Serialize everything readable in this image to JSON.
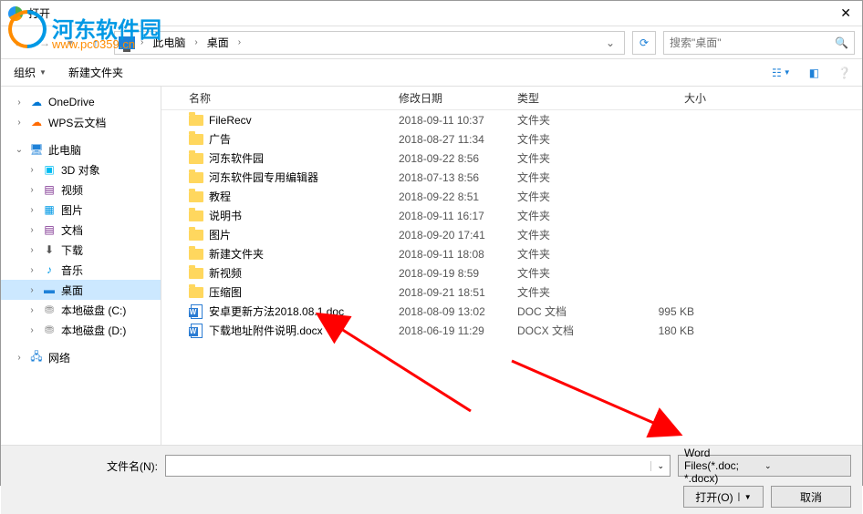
{
  "window": {
    "title": "打开"
  },
  "watermark": {
    "text": "河东软件园",
    "url": "www.pc0359.cn"
  },
  "breadcrumb": {
    "loc": "此电脑",
    "path": "桌面"
  },
  "search": {
    "placeholder": "搜索\"桌面\""
  },
  "toolbar": {
    "organize": "组织",
    "newfolder": "新建文件夹"
  },
  "sidebar": {
    "items": [
      {
        "label": "OneDrive",
        "indent": 1,
        "icon": "onedrive",
        "exp": ">"
      },
      {
        "label": "WPS云文档",
        "indent": 1,
        "icon": "wps",
        "exp": ">"
      },
      {
        "label": "",
        "spacer": true
      },
      {
        "label": "此电脑",
        "indent": 1,
        "icon": "pc",
        "exp": "v"
      },
      {
        "label": "3D 对象",
        "indent": 2,
        "icon": "3d",
        "exp": ">"
      },
      {
        "label": "视频",
        "indent": 2,
        "icon": "video",
        "exp": ">"
      },
      {
        "label": "图片",
        "indent": 2,
        "icon": "pic",
        "exp": ">"
      },
      {
        "label": "文档",
        "indent": 2,
        "icon": "doc",
        "exp": ">"
      },
      {
        "label": "下载",
        "indent": 2,
        "icon": "dl",
        "exp": ">"
      },
      {
        "label": "音乐",
        "indent": 2,
        "icon": "music",
        "exp": ">"
      },
      {
        "label": "桌面",
        "indent": 2,
        "icon": "desktop",
        "exp": ">",
        "selected": true
      },
      {
        "label": "本地磁盘 (C:)",
        "indent": 2,
        "icon": "drive",
        "exp": ">"
      },
      {
        "label": "本地磁盘 (D:)",
        "indent": 2,
        "icon": "drive",
        "exp": ">"
      },
      {
        "label": "",
        "spacer": true
      },
      {
        "label": "网络",
        "indent": 1,
        "icon": "net",
        "exp": ">"
      }
    ]
  },
  "columns": {
    "name": "名称",
    "date": "修改日期",
    "type": "类型",
    "size": "大小"
  },
  "files": [
    {
      "name": "FileRecv",
      "date": "2018-09-11 10:37",
      "type": "文件夹",
      "size": "",
      "kind": "folder"
    },
    {
      "name": "广告",
      "date": "2018-08-27 11:34",
      "type": "文件夹",
      "size": "",
      "kind": "folder"
    },
    {
      "name": "河东软件园",
      "date": "2018-09-22 8:56",
      "type": "文件夹",
      "size": "",
      "kind": "folder"
    },
    {
      "name": "河东软件园专用编辑器",
      "date": "2018-07-13 8:56",
      "type": "文件夹",
      "size": "",
      "kind": "folder"
    },
    {
      "name": "教程",
      "date": "2018-09-22 8:51",
      "type": "文件夹",
      "size": "",
      "kind": "folder"
    },
    {
      "name": "说明书",
      "date": "2018-09-11 16:17",
      "type": "文件夹",
      "size": "",
      "kind": "folder"
    },
    {
      "name": "图片",
      "date": "2018-09-20 17:41",
      "type": "文件夹",
      "size": "",
      "kind": "folder"
    },
    {
      "name": "新建文件夹",
      "date": "2018-09-11 18:08",
      "type": "文件夹",
      "size": "",
      "kind": "folder"
    },
    {
      "name": "新视频",
      "date": "2018-09-19 8:59",
      "type": "文件夹",
      "size": "",
      "kind": "folder"
    },
    {
      "name": "压缩图",
      "date": "2018-09-21 18:51",
      "type": "文件夹",
      "size": "",
      "kind": "folder"
    },
    {
      "name": "安卓更新方法2018.08.1.doc",
      "date": "2018-08-09 13:02",
      "type": "DOC 文档",
      "size": "995 KB",
      "kind": "doc"
    },
    {
      "name": "下载地址附件说明.docx",
      "date": "2018-06-19 11:29",
      "type": "DOCX 文档",
      "size": "180 KB",
      "kind": "doc"
    }
  ],
  "bottom": {
    "filename_label": "文件名(N):",
    "filter": "Word Files(*.doc; *.docx)",
    "open": "打开(O)",
    "cancel": "取消"
  }
}
